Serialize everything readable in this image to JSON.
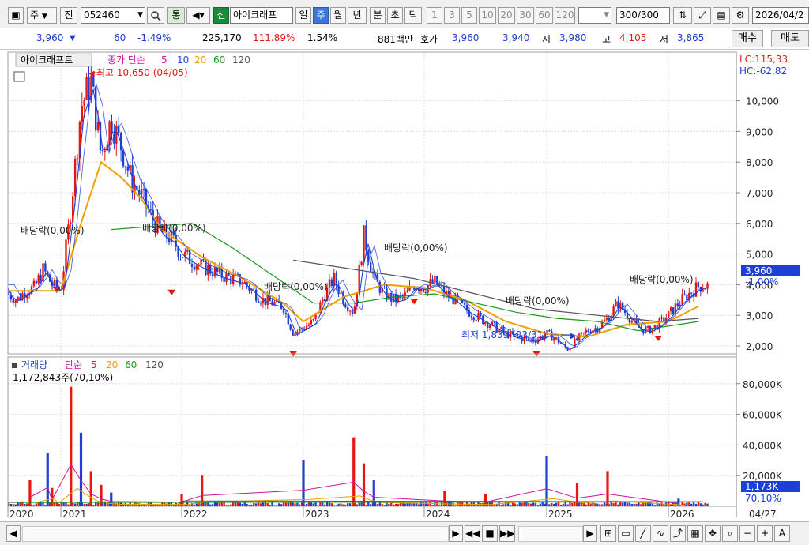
{
  "toolbar": {
    "stock_type": "주",
    "stock_all": "전",
    "code": "052460",
    "theme_btn": "통",
    "credit_badge": "신",
    "stock_name": "아이크래프",
    "periods": [
      "일",
      "주",
      "월",
      "년",
      "분",
      "초",
      "틱"
    ],
    "selected_period": "주",
    "intervals": [
      "1",
      "3",
      "5",
      "10",
      "20",
      "30",
      "60",
      "120"
    ],
    "count": "300",
    "count_total": "/300",
    "date": "2026/04/2"
  },
  "quote": {
    "price": "3,960",
    "change": "60",
    "change_pct": "-1.49%",
    "volume": "225,170",
    "vol_ratio": "111.89%",
    "turnover": "1.54%",
    "amount": "881백만",
    "ask_label": "호가",
    "ask1": "3,960",
    "ask2": "3,940",
    "open_label": "시",
    "open": "3,980",
    "high_label": "고",
    "high": "4,105",
    "low_label": "저",
    "low": "3,865",
    "buy_label": "매수",
    "sell_label": "매도"
  },
  "price_panel": {
    "name_tag": "아이크래프트",
    "legend_prefix": "종가 단순",
    "ma_periods": [
      "5",
      "10",
      "20",
      "60",
      "120"
    ],
    "lc": "LC:115,33",
    "hc": "HC:-62,82",
    "high_annot": "최고 10,650 (04/05)",
    "low_annot": "최저 1,839 (03/31)",
    "dividend_label": "배당락(0,00%)",
    "current_price": "3,960",
    "current_pct": "-1,00%"
  },
  "volume_panel": {
    "title": "거래량",
    "legend_prefix": "단순",
    "ma_periods": [
      "5",
      "20",
      "60",
      "120"
    ],
    "summary": "1,172,843주(70,10%)",
    "current_volume": "1,173K",
    "current_pct": "70,10%"
  },
  "colors": {
    "up": "#e8160c",
    "down": "#1e3fd6",
    "ma5": "#1e3fd6",
    "ma10": "#1e3fd6",
    "ma20": "#f0a000",
    "ma60": "#1a9a1a",
    "ma120": "#555555",
    "vol_ma5": "#d010a0",
    "grid": "#dcdcdc"
  },
  "chart_data": [
    {
      "type": "candlestick",
      "title": "아이크래프트",
      "interval": "weekly",
      "y_axis_ticks": [
        "2,000",
        "3,000",
        "4,000",
        "5,000",
        "6,000",
        "7,000",
        "8,000",
        "9,000",
        "10,000"
      ],
      "ylim": [
        1000,
        11200
      ],
      "x_axis_ticks": [
        "2020",
        "2021",
        "2022",
        "2023",
        "2024",
        "2025",
        "2026",
        "04/27"
      ],
      "series_names": [
        "5",
        "10",
        "20",
        "60",
        "120"
      ],
      "series": [
        {
          "name": "close",
          "points": [
            [
              "2020-01",
              3700
            ],
            [
              "2020-03",
              3500
            ],
            [
              "2020-05",
              3800
            ],
            [
              "2020-07",
              3900
            ],
            [
              "2020-09",
              4500
            ],
            [
              "2020-11",
              4000
            ],
            [
              "2021-01",
              3800
            ],
            [
              "2021-02",
              6500
            ],
            [
              "2021-03",
              9800
            ],
            [
              "2021-04",
              10650
            ],
            [
              "2021-05",
              8200
            ],
            [
              "2021-06",
              9400
            ],
            [
              "2021-07",
              8500
            ],
            [
              "2021-08",
              7400
            ],
            [
              "2021-09",
              6900
            ],
            [
              "2021-10",
              6200
            ],
            [
              "2021-11",
              5700
            ],
            [
              "2021-12",
              5500
            ],
            [
              "2022-01",
              5000
            ],
            [
              "2022-03",
              4600
            ],
            [
              "2022-05",
              4300
            ],
            [
              "2022-07",
              4100
            ],
            [
              "2022-09",
              3500
            ],
            [
              "2022-11",
              3300
            ],
            [
              "2022-12",
              2400
            ],
            [
              "2023-01",
              2600
            ],
            [
              "2023-02",
              2800
            ],
            [
              "2023-03",
              3600
            ],
            [
              "2023-04",
              4200
            ],
            [
              "2023-05",
              3500
            ],
            [
              "2023-06",
              3100
            ],
            [
              "2023-07",
              5600
            ],
            [
              "2023-08",
              4200
            ],
            [
              "2023-09",
              3700
            ],
            [
              "2023-10",
              3500
            ],
            [
              "2023-11",
              3600
            ],
            [
              "2023-12",
              4000
            ],
            [
              "2024-01",
              3900
            ],
            [
              "2024-02",
              4100
            ],
            [
              "2024-03",
              3700
            ],
            [
              "2024-04",
              3500
            ],
            [
              "2024-05",
              3200
            ],
            [
              "2024-06",
              3000
            ],
            [
              "2024-07",
              2800
            ],
            [
              "2024-08",
              2600
            ],
            [
              "2024-09",
              2400
            ],
            [
              "2024-10",
              2300
            ],
            [
              "2024-11",
              2200
            ],
            [
              "2024-12",
              2200
            ],
            [
              "2025-01",
              2400
            ],
            [
              "2025-02",
              2200
            ],
            [
              "2025-03",
              1900
            ],
            [
              "2025-04",
              2200
            ],
            [
              "2025-05",
              2500
            ],
            [
              "2025-06",
              2600
            ],
            [
              "2025-07",
              2900
            ],
            [
              "2025-08",
              3400
            ],
            [
              "2025-09",
              3000
            ],
            [
              "2025-10",
              2600
            ],
            [
              "2025-11",
              2500
            ],
            [
              "2025-12",
              2700
            ],
            [
              "2026-01",
              3000
            ],
            [
              "2026-02",
              3400
            ],
            [
              "2026-03",
              3700
            ],
            [
              "2026-04",
              3960
            ]
          ]
        },
        {
          "name": "ma20",
          "points": [
            [
              "2020-01",
              3800
            ],
            [
              "2020-07",
              3800
            ],
            [
              "2021-01",
              3800
            ],
            [
              "2021-03",
              6000
            ],
            [
              "2021-05",
              8000
            ],
            [
              "2021-07",
              7500
            ],
            [
              "2021-09",
              6800
            ],
            [
              "2021-11",
              5800
            ],
            [
              "2022-03",
              4900
            ],
            [
              "2022-07",
              4200
            ],
            [
              "2022-11",
              3400
            ],
            [
              "2023-01",
              2800
            ],
            [
              "2023-05",
              3600
            ],
            [
              "2023-09",
              4000
            ],
            [
              "2024-01",
              3900
            ],
            [
              "2024-05",
              3500
            ],
            [
              "2024-09",
              2800
            ],
            [
              "2025-01",
              2400
            ],
            [
              "2025-05",
              2300
            ],
            [
              "2025-09",
              2700
            ],
            [
              "2026-01",
              2800
            ],
            [
              "2026-04",
              3300
            ]
          ]
        },
        {
          "name": "ma60",
          "points": [
            [
              "2021-06",
              5800
            ],
            [
              "2021-10",
              5900
            ],
            [
              "2022-02",
              6000
            ],
            [
              "2022-06",
              5200
            ],
            [
              "2022-10",
              4300
            ],
            [
              "2023-02",
              3400
            ],
            [
              "2023-06",
              3400
            ],
            [
              "2023-10",
              3600
            ],
            [
              "2024-02",
              3700
            ],
            [
              "2024-06",
              3400
            ],
            [
              "2024-10",
              3100
            ],
            [
              "2025-02",
              2900
            ],
            [
              "2025-06",
              2800
            ],
            [
              "2025-10",
              2500
            ],
            [
              "2026-04",
              2800
            ]
          ]
        },
        {
          "name": "ma120",
          "points": [
            [
              "2022-12",
              4800
            ],
            [
              "2023-06",
              4500
            ],
            [
              "2023-12",
              4200
            ],
            [
              "2024-06",
              3700
            ],
            [
              "2024-12",
              3200
            ],
            [
              "2025-06",
              3000
            ],
            [
              "2025-12",
              2800
            ],
            [
              "2026-04",
              2900
            ]
          ]
        }
      ],
      "annotations": [
        {
          "text": "최고 10,650 (04/05)",
          "x": "2021-04",
          "y": 10650
        },
        {
          "text": "최저 1,839 (03/31)",
          "x": "2025-03",
          "y": 1839
        },
        {
          "text": "배당락(0,00%)",
          "x": "2020-12",
          "y": 4400
        },
        {
          "text": "배당락(0,00%)",
          "x": "2021-12",
          "y": 4300
        },
        {
          "text": "배당락(0,00%)",
          "x": "2022-12",
          "y": 2300
        },
        {
          "text": "배당락(0,00%)",
          "x": "2023-12",
          "y": 4000
        },
        {
          "text": "배당락(0,00%)",
          "x": "2024-12",
          "y": 2300
        },
        {
          "text": "배당락(0,00%)",
          "x": "2025-12",
          "y": 2800
        }
      ]
    },
    {
      "type": "bar",
      "title": "거래량",
      "y_axis_ticks": [
        "20,000K",
        "40,000K",
        "60,000K",
        "80,000K"
      ],
      "ylim": [
        0,
        90000
      ],
      "unit": "K",
      "x_axis_ticks": [
        "2020",
        "2021",
        "2022",
        "2023",
        "2024",
        "2025",
        "2026",
        "04/27"
      ],
      "series_names": [
        "5",
        "20",
        "60",
        "120"
      ],
      "spikes": [
        [
          "2020-06",
          17000
        ],
        [
          "2020-10",
          35000
        ],
        [
          "2020-11",
          12000
        ],
        [
          "2021-02",
          78000
        ],
        [
          "2021-03",
          48000
        ],
        [
          "2021-04",
          23000
        ],
        [
          "2021-05",
          14000
        ],
        [
          "2021-06",
          9000
        ],
        [
          "2022-01",
          8000
        ],
        [
          "2022-03",
          20000
        ],
        [
          "2023-01",
          30000
        ],
        [
          "2023-06",
          45000
        ],
        [
          "2023-07",
          28000
        ],
        [
          "2023-08",
          17000
        ],
        [
          "2024-03",
          10000
        ],
        [
          "2024-07",
          8000
        ],
        [
          "2025-01",
          33000
        ],
        [
          "2025-04",
          15000
        ],
        [
          "2025-07",
          23000
        ],
        [
          "2026-02",
          5000
        ]
      ],
      "current": 1173
    }
  ]
}
